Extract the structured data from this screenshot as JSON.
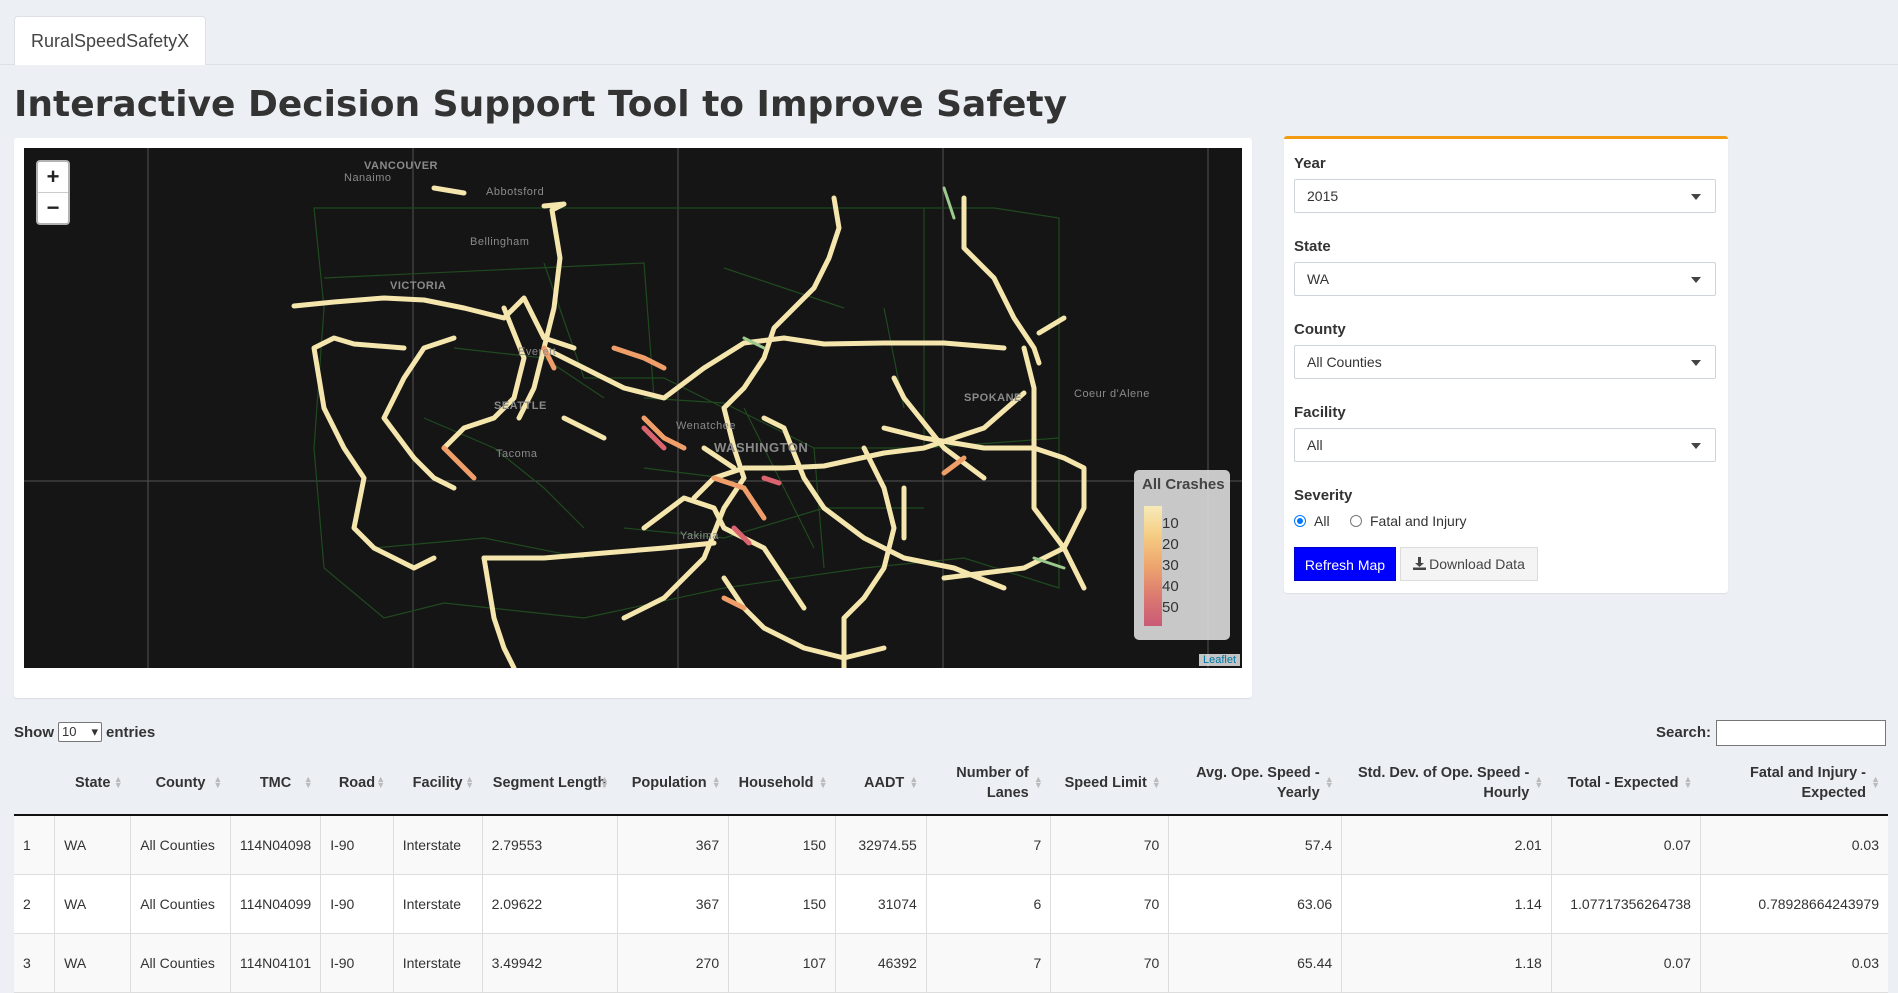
{
  "tab": {
    "label": "RuralSpeedSafetyX"
  },
  "page_title": "Interactive Decision Support Tool to Improve Safety",
  "map": {
    "zoom_in": "+",
    "zoom_out": "−",
    "labels": {
      "vancouver": "VANCOUVER",
      "nanaimo": "Nanaimo",
      "abbotsford": "Abbotsford",
      "bellingham": "Bellingham",
      "victoria": "VICTORIA",
      "everett": "Everett",
      "seattle": "SEATTLE",
      "tacoma": "Tacoma",
      "wenatchee": "Wenatchee",
      "washington": "WASHINGTON",
      "spokane": "SPOKANE",
      "coeur_dalene": "Coeur d'Alene",
      "yakima": "Yakima"
    },
    "legend": {
      "title": "All Crashes",
      "ticks": [
        "10",
        "20",
        "30",
        "40",
        "50"
      ]
    },
    "attribution": "Leaflet"
  },
  "panel": {
    "year": {
      "label": "Year",
      "value": "2015"
    },
    "state": {
      "label": "State",
      "value": "WA"
    },
    "county": {
      "label": "County",
      "value": "All Counties"
    },
    "facility": {
      "label": "Facility",
      "value": "All"
    },
    "severity": {
      "label": "Severity",
      "options": [
        "All",
        "Fatal and Injury"
      ],
      "selected": "All"
    },
    "refresh_label": "Refresh Map",
    "download_label": "Download Data"
  },
  "table": {
    "show_label": "Show",
    "entries_value": "10",
    "entries_label": "entries",
    "search_label": "Search:",
    "headers": [
      "",
      "State",
      "County",
      "TMC",
      "Road",
      "Facility",
      "Segment Length",
      "Population",
      "Household",
      "AADT",
      "Number of Lanes",
      "Speed Limit",
      "Avg. Ope. Speed - Yearly",
      "Std. Dev. of Ope. Speed - Hourly",
      "Total - Expected",
      "Fatal and Injury - Expected"
    ],
    "rows": [
      [
        "1",
        "WA",
        "All Counties",
        "114N04098",
        "I-90",
        "Interstate",
        "2.79553",
        "367",
        "150",
        "32974.55",
        "7",
        "70",
        "57.4",
        "2.01",
        "0.07",
        "0.03"
      ],
      [
        "2",
        "WA",
        "All Counties",
        "114N04099",
        "I-90",
        "Interstate",
        "2.09622",
        "367",
        "150",
        "31074",
        "6",
        "70",
        "63.06",
        "1.14",
        "1.07717356264738",
        "0.78928664243979"
      ],
      [
        "3",
        "WA",
        "All Counties",
        "114N04101",
        "I-90",
        "Interstate",
        "3.49942",
        "270",
        "107",
        "46392",
        "7",
        "70",
        "65.44",
        "1.18",
        "0.07",
        "0.03"
      ]
    ]
  }
}
